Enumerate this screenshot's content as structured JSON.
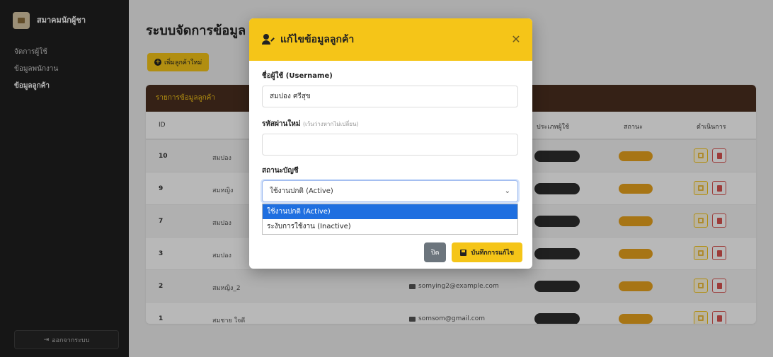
{
  "brand": {
    "name": "สมาคมนักผู้ชา",
    "subtitle": ""
  },
  "sidebar": {
    "items": [
      {
        "label": "จัดการผู้ใช้"
      },
      {
        "label": "ข้อมูลพนักงาน"
      },
      {
        "label": "ข้อมูลลูกค้า"
      }
    ],
    "logout_label": "ออกจากระบบ"
  },
  "main": {
    "title": "ระบบจัดการข้อมูล",
    "add_button": "เพิ่มลูกค้าใหม่",
    "card_title": "รายการข้อมูลลูกค้า",
    "columns": [
      "ID",
      "ประเภทผู้ใช้",
      "สถานะ",
      "ดำเนินการ"
    ],
    "rows": [
      {
        "id": "10",
        "username": "สมปอง",
        "email": ""
      },
      {
        "id": "9",
        "username": "สมหญิง",
        "email": ""
      },
      {
        "id": "7",
        "username": "สมปอง",
        "email": ""
      },
      {
        "id": "3",
        "username": "สมปอง",
        "email": ""
      },
      {
        "id": "2",
        "username": "สมหญิง_2",
        "email": "somying2@example.com"
      },
      {
        "id": "1",
        "username": "สมชาย ใจดี",
        "email": "somsom@gmail.com"
      }
    ]
  },
  "modal": {
    "title": "แก้ไขข้อมูลลูกค้า",
    "username_label": "ชื่อผู้ใช้ (Username)",
    "username_value": "สมปอง ศรีสุข",
    "password_label": "รหัสผ่านใหม่",
    "password_hint": "(เว้นว่างหากไม่เปลี่ยน)",
    "password_value": "",
    "status_label": "สถานะบัญชี",
    "status_selected": "ใช้งานปกติ (Active)",
    "status_options": [
      "ใช้งานปกติ (Active)",
      "ระงับการใช้งาน (Inactive)"
    ],
    "close_button": "ปิด",
    "save_button": "บันทึกการแก้ไข"
  },
  "colors": {
    "accent": "#f5c518",
    "sidebar_bg": "#1f1f1f",
    "card_header_bg": "#4a2f1f",
    "selected_option": "#1f6fe0",
    "status_badge": "#e8a31e",
    "delete": "#d9534f"
  }
}
